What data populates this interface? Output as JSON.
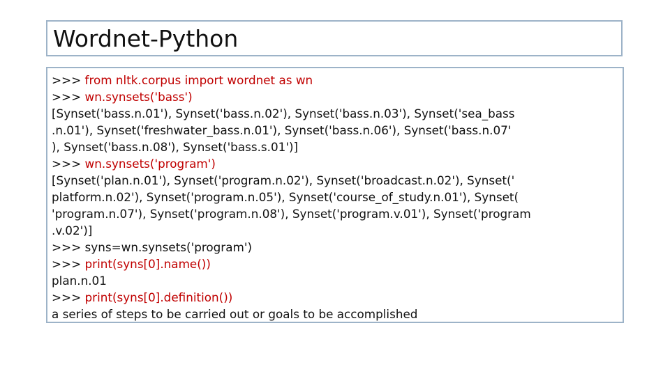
{
  "slide": {
    "title": "Wordnet-Python"
  },
  "code": {
    "prompt": ">>> ",
    "lines": [
      {
        "prompt": true,
        "text": "from nltk.corpus import wordnet as wn",
        "red": true
      },
      {
        "prompt": true,
        "text": "wn.synsets('bass')",
        "red": true
      },
      {
        "prompt": false,
        "text": "[Synset('bass.n.01'), Synset('bass.n.02'), Synset('bass.n.03'), Synset('sea_bass",
        "red": false
      },
      {
        "prompt": false,
        "text": ".n.01'), Synset('freshwater_bass.n.01'), Synset('bass.n.06'), Synset('bass.n.07'",
        "red": false
      },
      {
        "prompt": false,
        "text": "), Synset('bass.n.08'), Synset('bass.s.01')]",
        "red": false
      },
      {
        "prompt": true,
        "text": "wn.synsets('program')",
        "red": true
      },
      {
        "prompt": false,
        "text": "[Synset('plan.n.01'), Synset('program.n.02'), Synset('broadcast.n.02'), Synset('",
        "red": false
      },
      {
        "prompt": false,
        "text": "platform.n.02'), Synset('program.n.05'), Synset('course_of_study.n.01'), Synset(",
        "red": false
      },
      {
        "prompt": false,
        "text": "'program.n.07'), Synset('program.n.08'), Synset('program.v.01'), Synset('program",
        "red": false
      },
      {
        "prompt": false,
        "text": ".v.02')]",
        "red": false
      },
      {
        "prompt": true,
        "text": "syns=wn.synsets('program')",
        "red": false
      },
      {
        "prompt": true,
        "text": "print(syns[0].name())",
        "red": true
      },
      {
        "prompt": false,
        "text": "plan.n.01",
        "red": false
      },
      {
        "prompt": true,
        "text": "print(syns[0].definition())",
        "red": true
      },
      {
        "prompt": false,
        "text": "a series of steps to be carried out or goals to be accomplished",
        "red": false
      }
    ]
  },
  "colors": {
    "command": "#c00000",
    "text": "#111111",
    "border": "#9db3c8"
  }
}
